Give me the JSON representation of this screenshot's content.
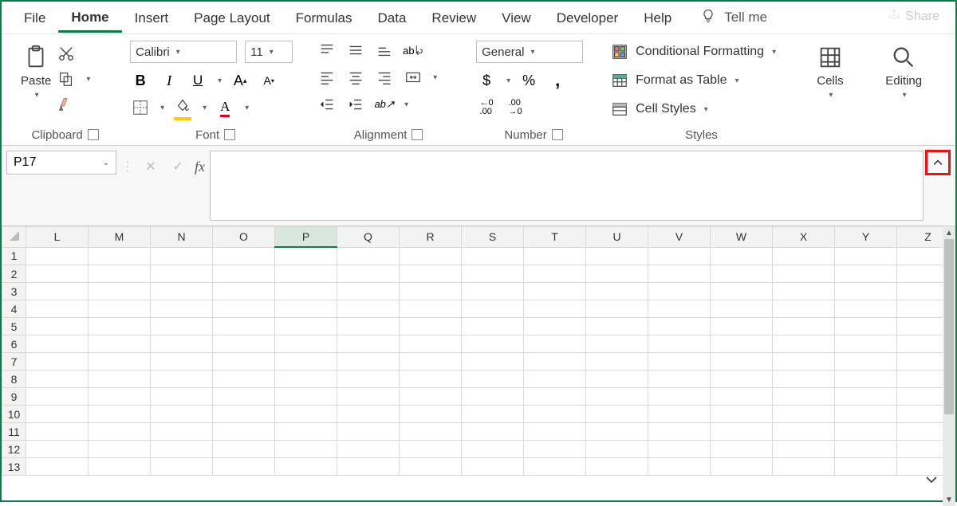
{
  "tabs": {
    "file": "File",
    "home": "Home",
    "insert": "Insert",
    "pageLayout": "Page Layout",
    "formulas": "Formulas",
    "data": "Data",
    "review": "Review",
    "view": "View",
    "developer": "Developer",
    "help": "Help",
    "tellme": "Tell me",
    "share": "Share"
  },
  "ribbon": {
    "clipboard": {
      "paste": "Paste",
      "label": "Clipboard"
    },
    "font": {
      "name": "Calibri",
      "size": "11",
      "bold": "B",
      "italic": "I",
      "underline": "U",
      "label": "Font"
    },
    "alignment": {
      "wrap": "ab",
      "label": "Alignment"
    },
    "number": {
      "format": "General",
      "currency": "$",
      "percent": "%",
      "comma": ",",
      "label": "Number"
    },
    "styles": {
      "cond": "Conditional Formatting",
      "table": "Format as Table",
      "cell": "Cell Styles",
      "label": "Styles"
    },
    "cells": {
      "label": "Cells"
    },
    "editing": {
      "label": "Editing"
    }
  },
  "formulaBar": {
    "nameBox": "P17"
  },
  "grid": {
    "columns": [
      "L",
      "M",
      "N",
      "O",
      "P",
      "Q",
      "R",
      "S",
      "T",
      "U",
      "V",
      "W",
      "X",
      "Y",
      "Z"
    ],
    "selectedColumn": "P",
    "rows": [
      "1",
      "2",
      "3",
      "4",
      "5",
      "6",
      "7",
      "8",
      "9",
      "10",
      "11",
      "12",
      "13"
    ]
  }
}
